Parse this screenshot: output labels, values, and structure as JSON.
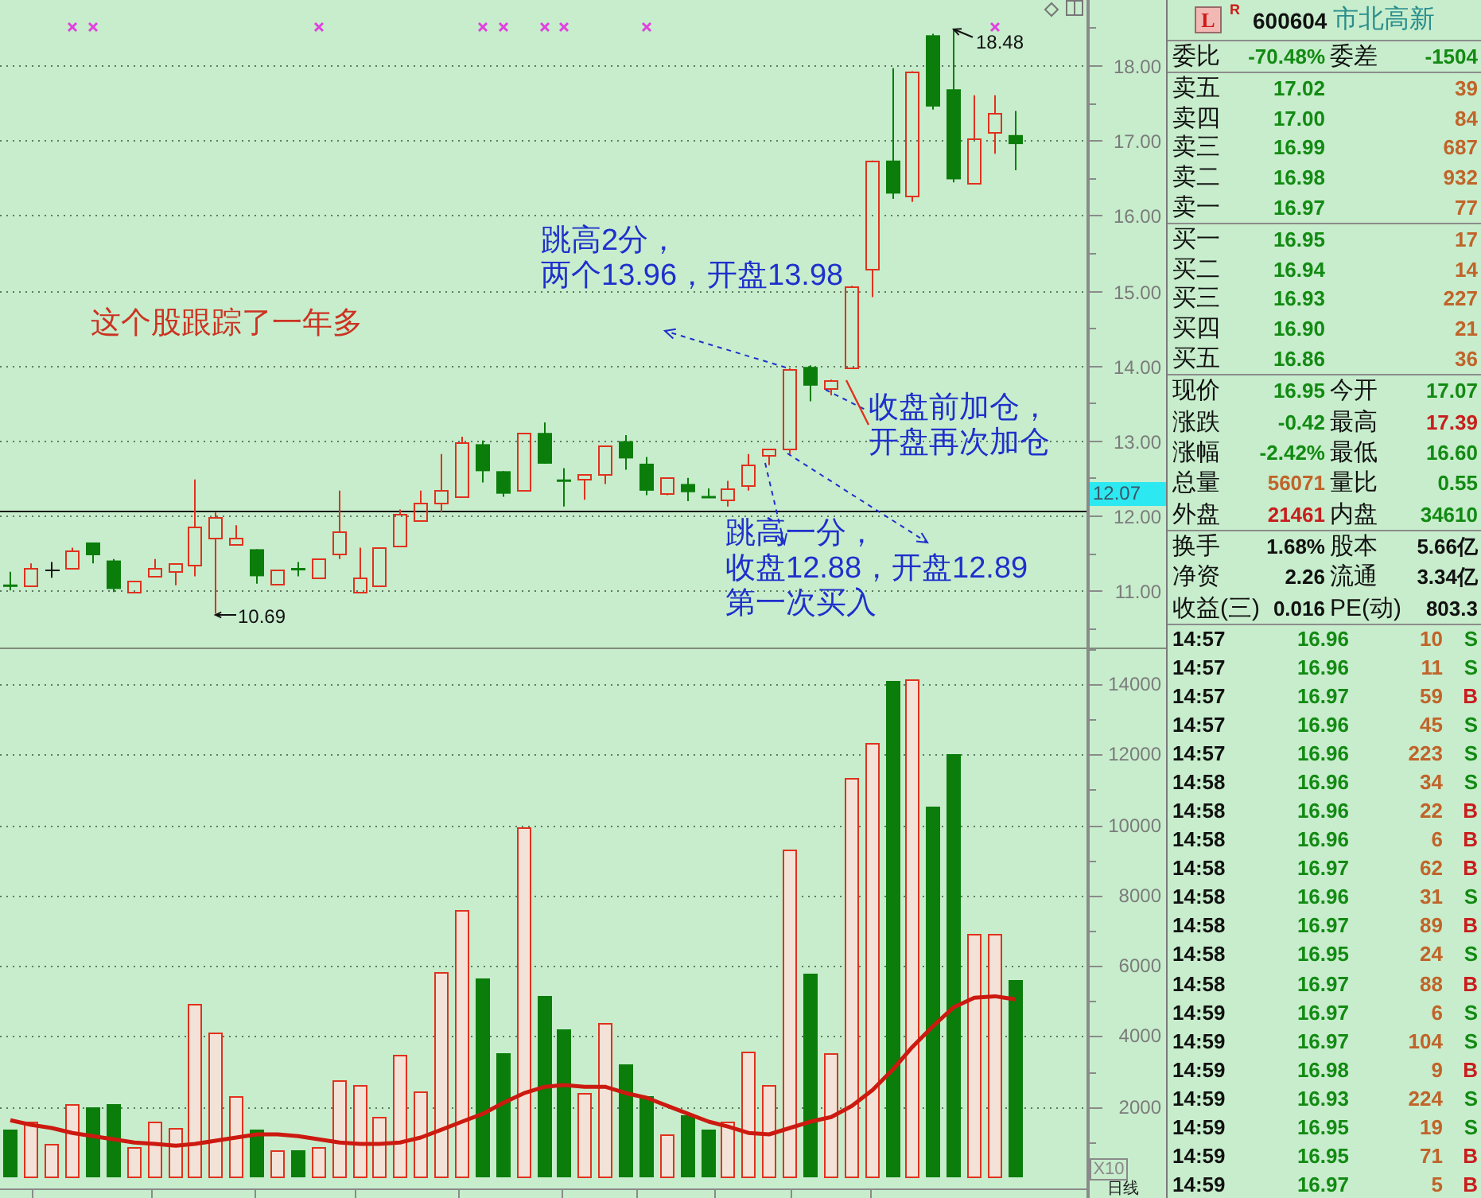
{
  "price_chart": {
    "chart_data": {
      "type": "candlestick",
      "grid": true,
      "categories": [
        null,
        null,
        null,
        null,
        null,
        null,
        null,
        null,
        null,
        null,
        null,
        null,
        null,
        null,
        null,
        null,
        null,
        null,
        null,
        null,
        null,
        null,
        null,
        null,
        null,
        null,
        null,
        null,
        null,
        null,
        null,
        null,
        null,
        null,
        null,
        null,
        null,
        null,
        null,
        null,
        null,
        null,
        null,
        null,
        null,
        null,
        null,
        null,
        null,
        null,
        null,
        null,
        null
      ],
      "ylim": [
        10.24,
        18.87
      ],
      "yticks": [
        {
          "value": 11,
          "label": "11.00"
        },
        {
          "value": 12,
          "label": "12.00"
        },
        {
          "value": 13,
          "label": "13.00"
        },
        {
          "value": 14,
          "label": "14.00"
        },
        {
          "value": 15,
          "label": "15.00"
        },
        {
          "value": 16,
          "label": "16.00"
        },
        {
          "value": 17,
          "label": "17.00"
        },
        {
          "value": 18,
          "label": "18.00"
        }
      ],
      "ohlc": [
        [
          11.08,
          11.25,
          11.0,
          11.05
        ],
        [
          11.07,
          11.36,
          11.07,
          11.3
        ],
        [
          11.28,
          11.38,
          11.17,
          11.28
        ],
        [
          11.3,
          11.57,
          11.3,
          11.53
        ],
        [
          11.64,
          11.64,
          11.36,
          11.47
        ],
        [
          11.4,
          11.42,
          10.98,
          11.02
        ],
        [
          10.98,
          11.13,
          10.98,
          11.13
        ],
        [
          11.19,
          11.42,
          11.19,
          11.3
        ],
        [
          11.26,
          11.36,
          11.07,
          11.36
        ],
        [
          11.34,
          12.48,
          11.19,
          11.85
        ],
        [
          11.7,
          12.04,
          10.69,
          11.97
        ],
        [
          11.62,
          11.87,
          11.62,
          11.7
        ],
        [
          11.55,
          11.55,
          11.09,
          11.19
        ],
        [
          11.09,
          11.28,
          11.09,
          11.28
        ],
        [
          11.3,
          11.38,
          11.19,
          11.29
        ],
        [
          11.17,
          11.42,
          11.17,
          11.42
        ],
        [
          11.49,
          12.33,
          11.42,
          11.78
        ],
        [
          10.98,
          11.57,
          10.98,
          11.17
        ],
        [
          11.07,
          11.57,
          11.07,
          11.57
        ],
        [
          11.59,
          12.08,
          11.59,
          12.02
        ],
        [
          11.93,
          12.33,
          11.93,
          12.17
        ],
        [
          12.17,
          12.82,
          12.04,
          12.33
        ],
        [
          12.25,
          13.05,
          12.25,
          12.97
        ],
        [
          12.95,
          13.0,
          12.44,
          12.59
        ],
        [
          12.59,
          12.59,
          12.25,
          12.29
        ],
        [
          12.33,
          13.1,
          12.33,
          13.1
        ],
        [
          13.1,
          13.24,
          12.69,
          12.69
        ],
        [
          12.48,
          12.63,
          12.12,
          12.47
        ],
        [
          12.48,
          12.55,
          12.21,
          12.55
        ],
        [
          12.55,
          12.93,
          12.42,
          12.93
        ],
        [
          12.99,
          13.07,
          12.61,
          12.76
        ],
        [
          12.69,
          12.78,
          12.27,
          12.33
        ],
        [
          12.29,
          12.5,
          12.27,
          12.5
        ],
        [
          12.42,
          12.5,
          12.19,
          12.31
        ],
        [
          12.26,
          12.36,
          12.25,
          12.25
        ],
        [
          12.21,
          12.46,
          12.12,
          12.36
        ],
        [
          12.4,
          12.82,
          12.33,
          12.67
        ],
        [
          12.8,
          12.88,
          12.67,
          12.88
        ],
        [
          12.89,
          13.96,
          12.8,
          13.96
        ],
        [
          13.98,
          14.0,
          13.52,
          13.73
        ],
        [
          13.69,
          13.81,
          13.6,
          13.81
        ],
        [
          13.98,
          15.06,
          13.98,
          15.06
        ],
        [
          15.29,
          16.73,
          14.91,
          16.73
        ],
        [
          16.73,
          17.96,
          16.22,
          16.29
        ],
        [
          16.27,
          17.92,
          16.18,
          17.92
        ],
        [
          18.4,
          18.42,
          17.41,
          17.45
        ],
        [
          17.68,
          18.48,
          16.44,
          16.48
        ],
        [
          16.44,
          17.6,
          16.44,
          17.03
        ],
        [
          17.11,
          17.6,
          16.82,
          17.37
        ],
        [
          17.07,
          17.39,
          16.6,
          16.95
        ],
        null,
        null,
        null
      ],
      "annotations": [
        "18.48",
        "10.69"
      ],
      "ref_lines": [
        {
          "axis": "y",
          "value": 12.07,
          "label": "12.07"
        }
      ]
    },
    "marks": [
      false,
      false,
      false,
      true,
      true,
      false,
      false,
      false,
      false,
      false,
      false,
      false,
      false,
      false,
      false,
      true,
      false,
      false,
      false,
      false,
      false,
      false,
      false,
      true,
      true,
      false,
      true,
      true,
      false,
      false,
      false,
      true,
      false,
      false,
      false,
      false,
      false,
      false,
      false,
      false,
      false,
      false,
      false,
      false,
      false,
      false,
      false,
      false,
      true,
      false
    ],
    "notes": [
      {
        "lines": [
          "这个股跟踪了一年多"
        ],
        "color": "#cc3322"
      },
      {
        "lines": [
          "跳高2分，",
          "两个13.96，开盘13.98"
        ],
        "color": "#1f30cc"
      },
      {
        "lines": [
          "收盘前加仓，",
          "开盘再次加仓"
        ],
        "color": "#1f30cc"
      },
      {
        "lines": [
          "跳高一分，",
          "收盘12.88，开盘12.89",
          "第一次买入"
        ],
        "color": "#1f30cc"
      }
    ]
  },
  "volume_chart": {
    "chart_data": {
      "type": "bar",
      "grid": true,
      "categories": [
        null,
        null,
        null,
        null,
        null,
        null,
        null,
        null,
        null,
        null,
        null,
        null,
        null,
        null,
        null,
        null,
        null,
        null,
        null,
        null,
        null,
        null,
        null,
        null,
        null,
        null,
        null,
        null,
        null,
        null,
        null,
        null,
        null,
        null,
        null,
        null,
        null,
        null,
        null,
        null,
        null,
        null,
        null,
        null,
        null,
        null,
        null,
        null,
        null,
        null,
        null,
        null,
        null
      ],
      "ylim": [
        0,
        15040
      ],
      "yticks": [
        {
          "value": 2000,
          "label": "2000"
        },
        {
          "value": 4000,
          "label": "4000"
        },
        {
          "value": 6000,
          "label": "6000"
        },
        {
          "value": 8000,
          "label": "8000"
        },
        {
          "value": 10000,
          "label": "10000"
        },
        {
          "value": 12000,
          "label": "12000"
        },
        {
          "value": 14000,
          "label": "14000"
        }
      ],
      "series": [
        {
          "values": [
            1350,
            1580,
            950,
            2080,
            1980,
            2080,
            860,
            1580,
            1400,
            4920,
            4100,
            2300,
            1350,
            770,
            770,
            860,
            2750,
            2620,
            1710,
            3470,
            2440,
            5820,
            7580,
            5640,
            3520,
            9920,
            5140,
            4200,
            2390,
            4370,
            3200,
            2300,
            1220,
            1760,
            1350,
            1580,
            3560,
            2620,
            9290,
            5770,
            3520,
            11320,
            12310,
            14070,
            14120,
            10510,
            12000,
            6900,
            6900,
            5590,
            null,
            null,
            null
          ],
          "colors": [
            "#0a7d0a",
            "#e0321e",
            "#e0321e",
            "#e0321e",
            "#0a7d0a",
            "#0a7d0a",
            "#e0321e",
            "#e0321e",
            "#e0321e",
            "#e0321e",
            "#e0321e",
            "#e0321e",
            "#0a7d0a",
            "#e0321e",
            "#0a7d0a",
            "#e0321e",
            "#e0321e",
            "#e0321e",
            "#e0321e",
            "#e0321e",
            "#e0321e",
            "#e0321e",
            "#e0321e",
            "#0a7d0a",
            "#0a7d0a",
            "#e0321e",
            "#0a7d0a",
            "#0a7d0a",
            "#e0321e",
            "#e0321e",
            "#0a7d0a",
            "#0a7d0a",
            "#e0321e",
            "#0a7d0a",
            "#0a7d0a",
            "#e0321e",
            "#e0321e",
            "#e0321e",
            "#e0321e",
            "#0a7d0a",
            "#e0321e",
            "#e0321e",
            "#e0321e",
            "#0a7d0a",
            "#e0321e",
            "#0a7d0a",
            "#0a7d0a",
            "#e0321e",
            "#e0321e",
            "#0a7d0a",
            null,
            null,
            null
          ]
        },
        {
          "type": "line",
          "color": "#cc1a10",
          "values": [
            1620,
            1490,
            1400,
            1260,
            1170,
            1080,
            990,
            950,
            900,
            950,
            1040,
            1130,
            1220,
            1220,
            1170,
            1080,
            990,
            950,
            950,
            990,
            1130,
            1350,
            1580,
            1800,
            2120,
            2390,
            2570,
            2620,
            2570,
            2570,
            2390,
            2260,
            2030,
            1800,
            1580,
            1440,
            1260,
            1220,
            1400,
            1580,
            1710,
            2030,
            2480,
            3070,
            3700,
            4290,
            4830,
            5100,
            5140,
            5050,
            null,
            null,
            null
          ]
        }
      ]
    },
    "unit": "X10",
    "period": "日线"
  },
  "quote_panel": {
    "header": {
      "badge": "L",
      "mark": "R",
      "code": "600604",
      "name": "市北高新"
    },
    "ratio": [
      {
        "label": "委比",
        "value": "-70.48%"
      },
      {
        "label": "委差",
        "value": "-1504"
      }
    ],
    "asks": [
      {
        "label": "卖五",
        "price": "17.02",
        "volume": "39"
      },
      {
        "label": "卖四",
        "price": "17.00",
        "volume": "84"
      },
      {
        "label": "卖三",
        "price": "16.99",
        "volume": "687"
      },
      {
        "label": "卖二",
        "price": "16.98",
        "volume": "932"
      },
      {
        "label": "卖一",
        "price": "16.97",
        "volume": "77"
      }
    ],
    "bids": [
      {
        "label": "买一",
        "price": "16.95",
        "volume": "17"
      },
      {
        "label": "买二",
        "price": "16.94",
        "volume": "14"
      },
      {
        "label": "买三",
        "price": "16.93",
        "volume": "227"
      },
      {
        "label": "买四",
        "price": "16.90",
        "volume": "21"
      },
      {
        "label": "买五",
        "price": "16.86",
        "volume": "36"
      }
    ],
    "stats": [
      {
        "label": "现价",
        "value": "16.95",
        "color": "#138a13"
      },
      {
        "label": "今开",
        "value": "17.07",
        "color": "#138a13"
      },
      {
        "label": "涨跌",
        "value": "-0.42",
        "color": "#138a13"
      },
      {
        "label": "最高",
        "value": "17.39",
        "color": "#c81e1e"
      },
      {
        "label": "涨幅",
        "value": "-2.42%",
        "color": "#138a13"
      },
      {
        "label": "最低",
        "value": "16.60",
        "color": "#138a13"
      },
      {
        "label": "总量",
        "value": "56071",
        "color": "#c0642a"
      },
      {
        "label": "量比",
        "value": "0.55",
        "color": "#138a13"
      },
      {
        "label": "外盘",
        "value": "21461",
        "color": "#c81e1e"
      },
      {
        "label": "内盘",
        "value": "34610",
        "color": "#138a13"
      }
    ],
    "fundamentals": [
      {
        "label": "换手",
        "value": "1.68%"
      },
      {
        "label": "股本",
        "value": "5.66亿"
      },
      {
        "label": "净资",
        "value": "2.26"
      },
      {
        "label": "流通",
        "value": "3.34亿"
      },
      {
        "label": "收益(三)",
        "value": "0.016"
      },
      {
        "label": "PE(动)",
        "value": "803.3"
      }
    ],
    "ticks": [
      {
        "time": "14:57",
        "price": "16.96",
        "volume": "10",
        "side": "S",
        "kind": "sell"
      },
      {
        "time": "14:57",
        "price": "16.96",
        "volume": "11",
        "side": "S",
        "kind": "sell"
      },
      {
        "time": "14:57",
        "price": "16.97",
        "volume": "59",
        "side": "B",
        "kind": "buy"
      },
      {
        "time": "14:57",
        "price": "16.96",
        "volume": "45",
        "side": "S",
        "kind": "sell"
      },
      {
        "time": "14:57",
        "price": "16.96",
        "volume": "223",
        "side": "S",
        "kind": "sell"
      },
      {
        "time": "14:58",
        "price": "16.96",
        "volume": "34",
        "side": "S",
        "kind": "sell"
      },
      {
        "time": "14:58",
        "price": "16.96",
        "volume": "22",
        "side": "B",
        "kind": "buy"
      },
      {
        "time": "14:58",
        "price": "16.96",
        "volume": "6",
        "side": "B",
        "kind": "buy"
      },
      {
        "time": "14:58",
        "price": "16.97",
        "volume": "62",
        "side": "B",
        "kind": "buy"
      },
      {
        "time": "14:58",
        "price": "16.96",
        "volume": "31",
        "side": "S",
        "kind": "sell"
      },
      {
        "time": "14:58",
        "price": "16.97",
        "volume": "89",
        "side": "B",
        "kind": "buy"
      },
      {
        "time": "14:58",
        "price": "16.95",
        "volume": "24",
        "side": "S",
        "kind": "sell"
      },
      {
        "time": "14:58",
        "price": "16.97",
        "volume": "88",
        "side": "B",
        "kind": "buy"
      },
      {
        "time": "14:59",
        "price": "16.97",
        "volume": "6",
        "side": "S",
        "kind": "sell"
      },
      {
        "time": "14:59",
        "price": "16.97",
        "volume": "104",
        "side": "S",
        "kind": "sell"
      },
      {
        "time": "14:59",
        "price": "16.98",
        "volume": "9",
        "side": "B",
        "kind": "buy"
      },
      {
        "time": "14:59",
        "price": "16.93",
        "volume": "224",
        "side": "S",
        "kind": "sell"
      },
      {
        "time": "14:59",
        "price": "16.95",
        "volume": "19",
        "side": "S",
        "kind": "sell"
      },
      {
        "time": "14:59",
        "price": "16.95",
        "volume": "71",
        "side": "B",
        "kind": "buy"
      },
      {
        "time": "14:59",
        "price": "16.97",
        "volume": "5",
        "side": "B",
        "kind": "buy"
      }
    ]
  }
}
